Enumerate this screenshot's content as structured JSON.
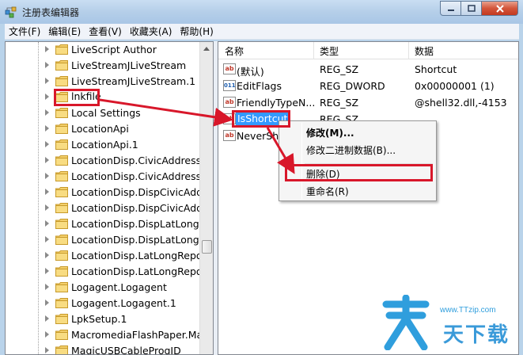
{
  "window": {
    "title": "注册表编辑器"
  },
  "menubar": [
    {
      "label": "文件(F)"
    },
    {
      "label": "编辑(E)"
    },
    {
      "label": "查看(V)"
    },
    {
      "label": "收藏夹(A)"
    },
    {
      "label": "帮助(H)"
    }
  ],
  "tree": {
    "items": [
      {
        "label": "LiveScript Author"
      },
      {
        "label": "LiveStreamJLiveStream"
      },
      {
        "label": "LiveStreamJLiveStream.1"
      },
      {
        "label": "lnkfile"
      },
      {
        "label": "Local Settings"
      },
      {
        "label": "LocationApi"
      },
      {
        "label": "LocationApi.1"
      },
      {
        "label": "LocationDisp.CivicAddressRe"
      },
      {
        "label": "LocationDisp.CivicAddressRe"
      },
      {
        "label": "LocationDisp.DispCivicAddre"
      },
      {
        "label": "LocationDisp.DispCivicAddre"
      },
      {
        "label": "LocationDisp.DispLatLongRe"
      },
      {
        "label": "LocationDisp.DispLatLongRe"
      },
      {
        "label": "LocationDisp.LatLongReport"
      },
      {
        "label": "LocationDisp.LatLongReport"
      },
      {
        "label": "Logagent.Logagent"
      },
      {
        "label": "Logagent.Logagent.1"
      },
      {
        "label": "LpkSetup.1"
      },
      {
        "label": "MacromediaFlashPaper.Mac"
      },
      {
        "label": "MagicUSBCableProgID"
      }
    ]
  },
  "list": {
    "headers": {
      "name": "名称",
      "type": "类型",
      "data": "数据"
    },
    "rows": [
      {
        "name": "(默认)",
        "type": "REG_SZ",
        "data": "Shortcut",
        "icon": "string-value-icon"
      },
      {
        "name": "EditFlags",
        "type": "REG_DWORD",
        "data": "0x00000001 (1)",
        "icon": "binary-value-icon"
      },
      {
        "name": "FriendlyTypeN...",
        "type": "REG_SZ",
        "data": "@shell32.dll,-4153",
        "icon": "string-value-icon"
      },
      {
        "name": "IsShortcut",
        "type": "REG_SZ",
        "data": "",
        "icon": "string-value-icon"
      },
      {
        "name": "NeverSho",
        "type": "",
        "data": "",
        "icon": "string-value-icon"
      }
    ]
  },
  "context_menu": {
    "items": [
      {
        "label": "修改(M)..."
      },
      {
        "label": "修改二进制数据(B)..."
      },
      {
        "label": "删除(D)"
      },
      {
        "label": "重命名(R)"
      }
    ]
  },
  "watermark": {
    "url": "www.TTzip.com",
    "text": "天下载"
  },
  "colors": {
    "annotation": "#d8172a",
    "selection": "#3399ff",
    "titlebar": "#b5cfe9"
  }
}
